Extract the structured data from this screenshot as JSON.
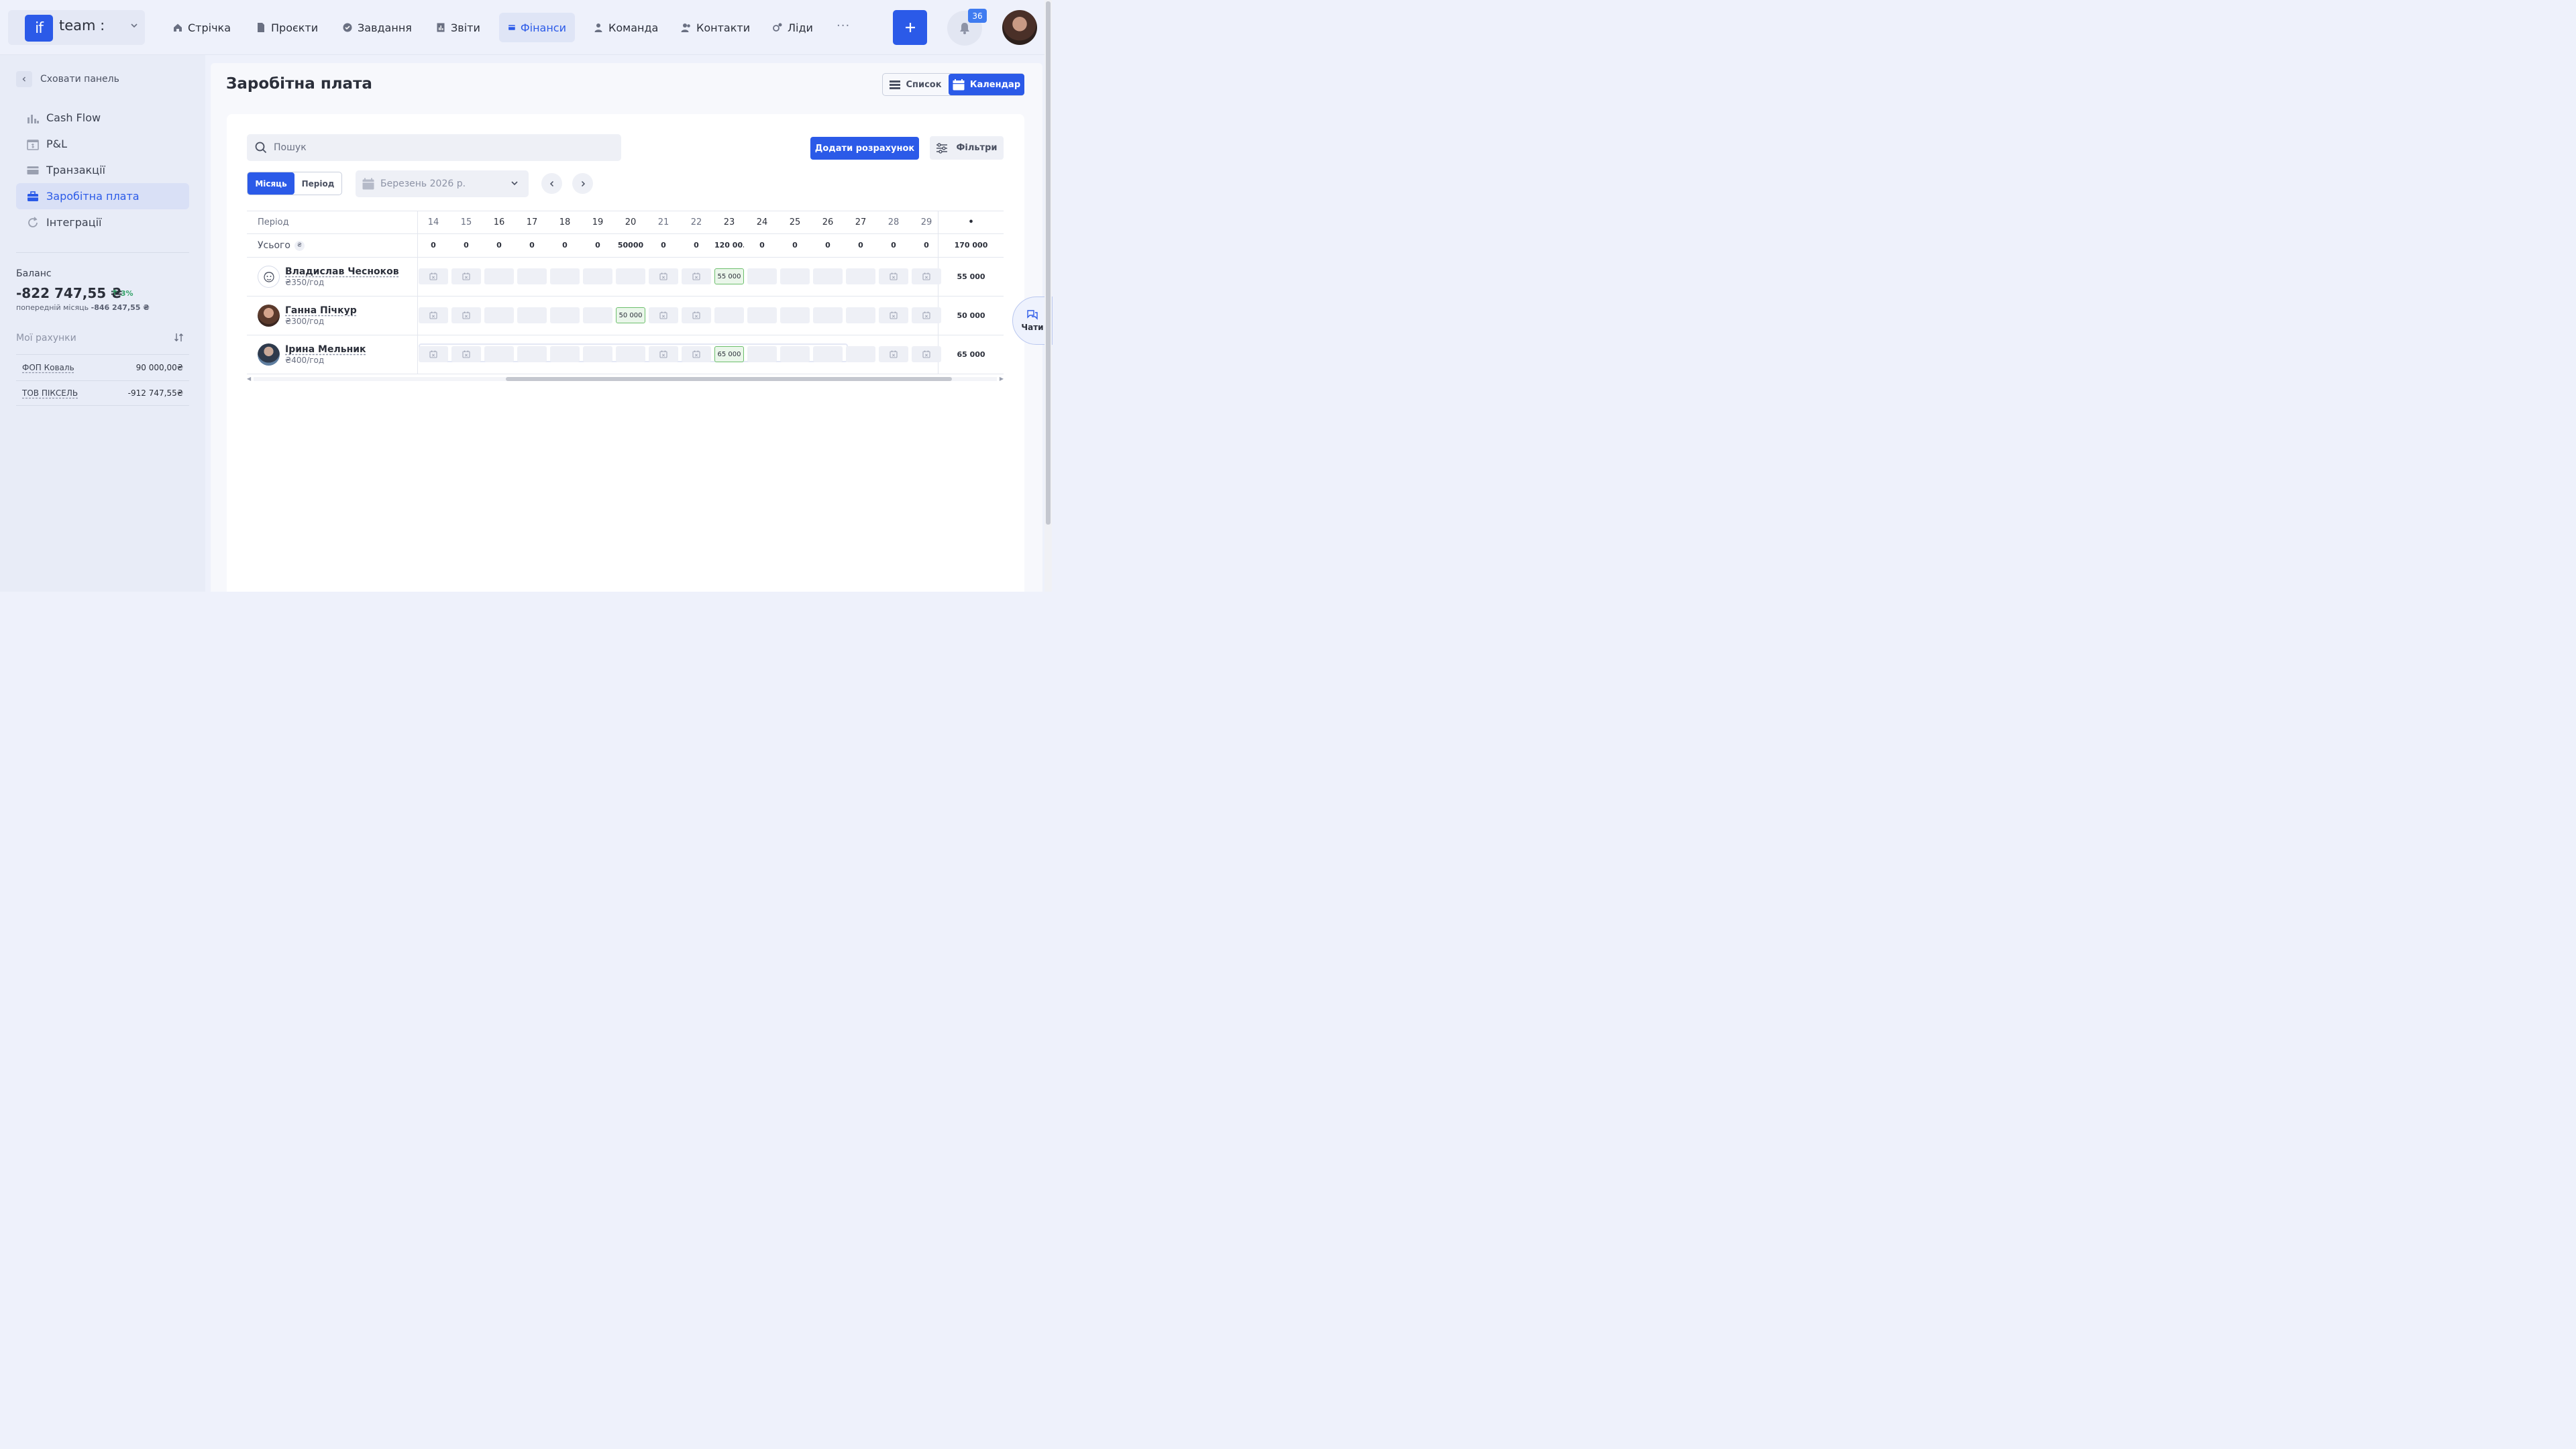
{
  "app": {
    "team_logo": "if",
    "team_name": "team :",
    "notifications_count": "36"
  },
  "nav": [
    {
      "label": "Стрічка",
      "icon": "home-icon"
    },
    {
      "label": "Проєкти",
      "icon": "document-icon"
    },
    {
      "label": "Завдання",
      "icon": "check-circle-icon"
    },
    {
      "label": "Звіти",
      "icon": "report-icon"
    },
    {
      "label": "Фінанси",
      "icon": "wallet-icon",
      "active": true
    },
    {
      "label": "Команда",
      "icon": "user-icon"
    },
    {
      "label": "Контакти",
      "icon": "contacts-icon"
    },
    {
      "label": "Ліди",
      "icon": "leads-icon"
    }
  ],
  "sidebar": {
    "hide_label": "Сховати панель",
    "items": [
      {
        "label": "Cash Flow",
        "icon": "cashflow-icon"
      },
      {
        "label": "P&L",
        "icon": "pnl-icon"
      },
      {
        "label": "Транзакції",
        "icon": "transactions-icon"
      },
      {
        "label": "Заробітна плата",
        "icon": "briefcase-icon",
        "active": true
      },
      {
        "label": "Інтеграції",
        "icon": "sync-icon"
      }
    ],
    "balance_label": "Баланс",
    "balance_value": "-822 747,55 ₴",
    "balance_delta": "3%",
    "balance_prev_label": "попередній місяць",
    "balance_prev_value": "-846 247,55 ₴",
    "accounts_label": "Мої рахунки",
    "accounts": [
      {
        "name": "ФОП Коваль",
        "value": "90 000,00₴"
      },
      {
        "name": "ТОВ ПІКСЕЛЬ",
        "value": "-912 747,55₴"
      }
    ]
  },
  "page": {
    "title": "Заробітна плата",
    "view_list": "Список",
    "view_calendar": "Календар",
    "search_placeholder": "Пошук",
    "add_calc": "Додати розрахунок",
    "filters": "Фільтри",
    "mode_month": "Місяць",
    "mode_period": "Період",
    "month_value": "Березень 2026 р."
  },
  "table": {
    "period_label": "Період",
    "total_label": "Усього",
    "currency_badge": "₴",
    "days": [
      "14",
      "15",
      "16",
      "17",
      "18",
      "19",
      "20",
      "21",
      "22",
      "23",
      "24",
      "25",
      "26",
      "27",
      "28",
      "29"
    ],
    "sum_header": "•",
    "day_totals": [
      "0",
      "0",
      "0",
      "0",
      "0",
      "0",
      "50000",
      "0",
      "0",
      "120 00...",
      "0",
      "0",
      "0",
      "0",
      "0",
      "0"
    ],
    "grand_total": "170 000",
    "employees": [
      {
        "name": "Владислав Чесноков",
        "rate": "₴350/год",
        "payment": "55 000",
        "total": "55 000"
      },
      {
        "name": "Ганна Пічкур",
        "rate": "₴300/год",
        "payment": "50 000",
        "total": "50 000"
      },
      {
        "name": "Ірина Мельник",
        "rate": "₴400/год",
        "payment": "65 000",
        "total": "65 000"
      }
    ]
  },
  "chat": {
    "label": "Чати"
  },
  "colors": {
    "accent": "#2b5ae8",
    "payment_border": "#6cbf6c",
    "delta_up": "#36a36a"
  }
}
